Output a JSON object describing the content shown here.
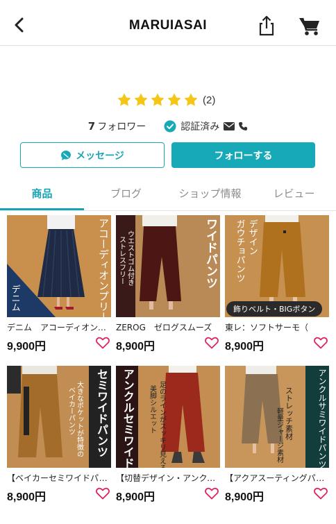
{
  "header": {
    "title": "MARUIASAI",
    "back_icon": "chevron-left-icon",
    "share_icon": "share-icon",
    "cart_icon": "cart-icon"
  },
  "shop": {
    "rating_stars": 5,
    "rating_count": "(2)",
    "followers_count": "7",
    "followers_label": "フォロワー",
    "verified_label": "認証済み",
    "star_color": "#f5c518"
  },
  "actions": {
    "message_label": "メッセージ",
    "follow_label": "フォローする",
    "accent_color": "#17a9b8"
  },
  "tabs": [
    {
      "label": "商品",
      "active": true
    },
    {
      "label": "ブログ",
      "active": false
    },
    {
      "label": "ショップ情報",
      "active": false
    },
    {
      "label": "レビュー",
      "active": false
    }
  ],
  "products": [
    {
      "name": "デニム　アコーディオンプリーツ",
      "price": "9,900円",
      "image_text": [
        "アコーディオンプリーツ",
        "デニム"
      ]
    },
    {
      "name": "ZEROG　ゼログスムーズ",
      "price": "8,900円",
      "image_text": [
        "ワイドパンツ",
        "ウエストゴム付き",
        "ストレスフリー"
      ]
    },
    {
      "name": "東レ：ソフトサーモ（",
      "price": "8,900円",
      "image_text": [
        "デザイン",
        "ガウチョパンツ",
        "飾りベルト・BIGボタン"
      ]
    },
    {
      "name": "【ベイカーセミワイドパンツ】",
      "price": "8,900円",
      "image_text": [
        "セミワイドパンツ",
        "大きなポケットが特徴の",
        "ベイカーパンツ"
      ]
    },
    {
      "name": "【切替デザイン・アンクル】",
      "price": "8,900円",
      "image_text": [
        "アンクルセミワイド",
        "足のラインがスッキリ見える",
        "美脚シルエット"
      ]
    },
    {
      "name": "【アクアスーティングパンツ】",
      "price": "8,900円",
      "image_text": [
        "アンクルサミワイドパンツ",
        "ストレッチ素材",
        "軽量ジャージ素材"
      ]
    }
  ]
}
